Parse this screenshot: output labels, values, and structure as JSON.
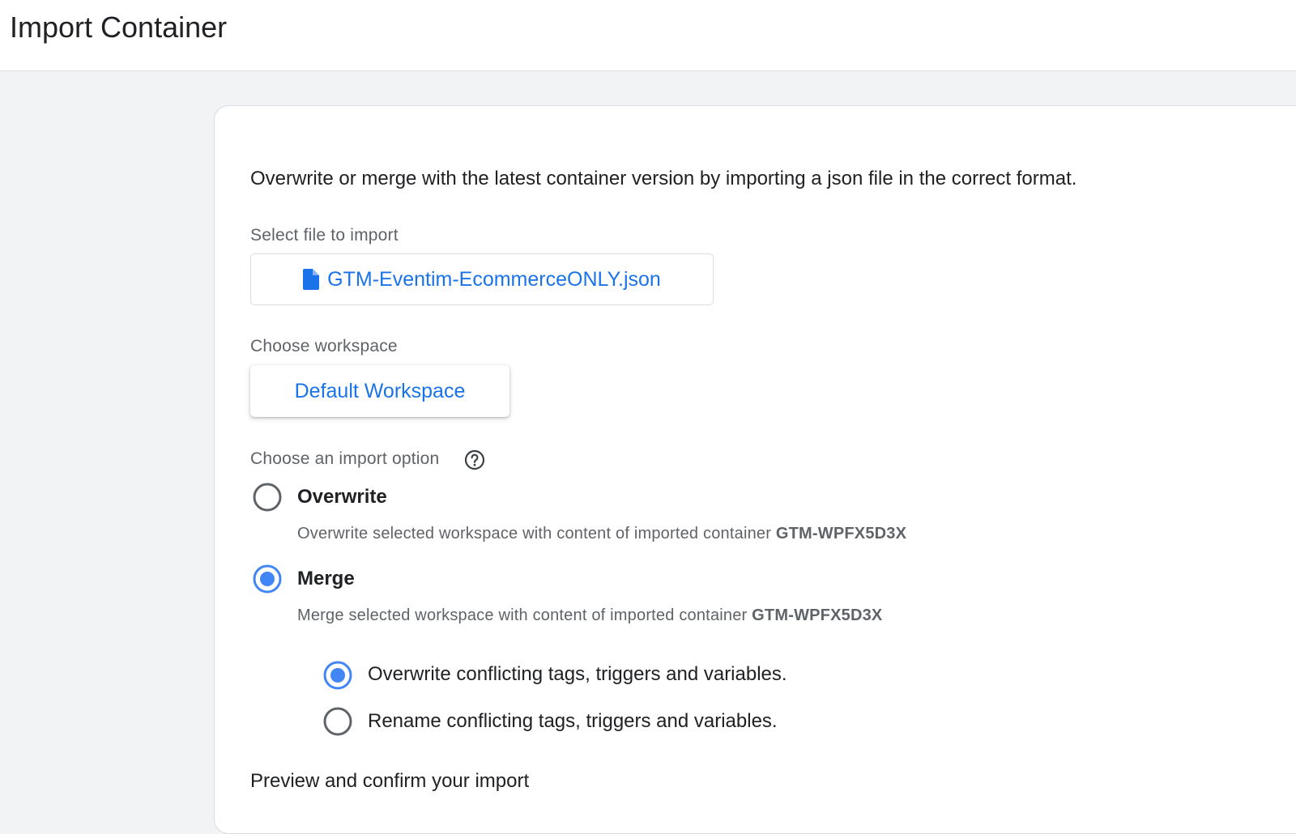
{
  "header": {
    "title": "Import Container"
  },
  "card": {
    "description": "Overwrite or merge with the latest container version by importing a json file in the correct format.",
    "file": {
      "label": "Select file to import",
      "file_name": "GTM-Eventim-EcommerceONLY.json",
      "icon": "file-document-icon"
    },
    "workspace": {
      "label": "Choose workspace",
      "selected": "Default Workspace"
    },
    "import_option": {
      "label": "Choose an import option",
      "help_icon": "help-circle-icon",
      "options": [
        {
          "title": "Overwrite",
          "description": "Overwrite selected workspace with content of imported container ",
          "container_id": "GTM-WPFX5D3X",
          "selected": false
        },
        {
          "title": "Merge",
          "description": "Merge selected workspace with content of imported container ",
          "container_id": "GTM-WPFX5D3X",
          "selected": true
        }
      ],
      "merge_sub_options": [
        {
          "label": "Overwrite conflicting tags, triggers and variables.",
          "selected": true
        },
        {
          "label": "Rename conflicting tags, triggers and variables.",
          "selected": false
        }
      ]
    },
    "next_section_cut": "Preview and confirm your import"
  },
  "colors": {
    "accent": "#1a73e8",
    "radio_selected": "#4285f4",
    "radio_unselected": "#5f6368",
    "page_bg": "#f1f3f4"
  }
}
